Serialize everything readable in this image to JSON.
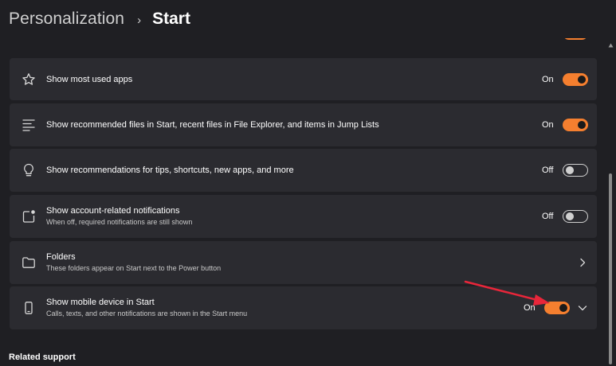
{
  "header": {
    "parent": "Personalization",
    "separator": "›",
    "current": "Start"
  },
  "settings": [
    {
      "icon": "star-icon",
      "title": "Show most used apps",
      "state": "On"
    },
    {
      "icon": "list-icon",
      "title": "Show recommended files in Start, recent files in File Explorer, and items in Jump Lists",
      "state": "On"
    },
    {
      "icon": "lightbulb-icon",
      "title": "Show recommendations for tips, shortcuts, new apps, and more",
      "state": "Off"
    },
    {
      "icon": "notification-icon",
      "title": "Show account-related notifications",
      "subtitle": "When off, required notifications are still shown",
      "state": "Off"
    },
    {
      "icon": "folder-icon",
      "title": "Folders",
      "subtitle": "These folders appear on Start next to the Power button"
    },
    {
      "icon": "mobile-device-icon",
      "title": "Show mobile device in Start",
      "subtitle": "Calls, texts, and other notifications are shown in the Start menu",
      "state": "On"
    }
  ],
  "related_support": "Related support",
  "colors": {
    "accent": "#f57f2f",
    "card": "#2b2b30",
    "background": "#1f1f23",
    "annotation_arrow": "#e8263a"
  }
}
